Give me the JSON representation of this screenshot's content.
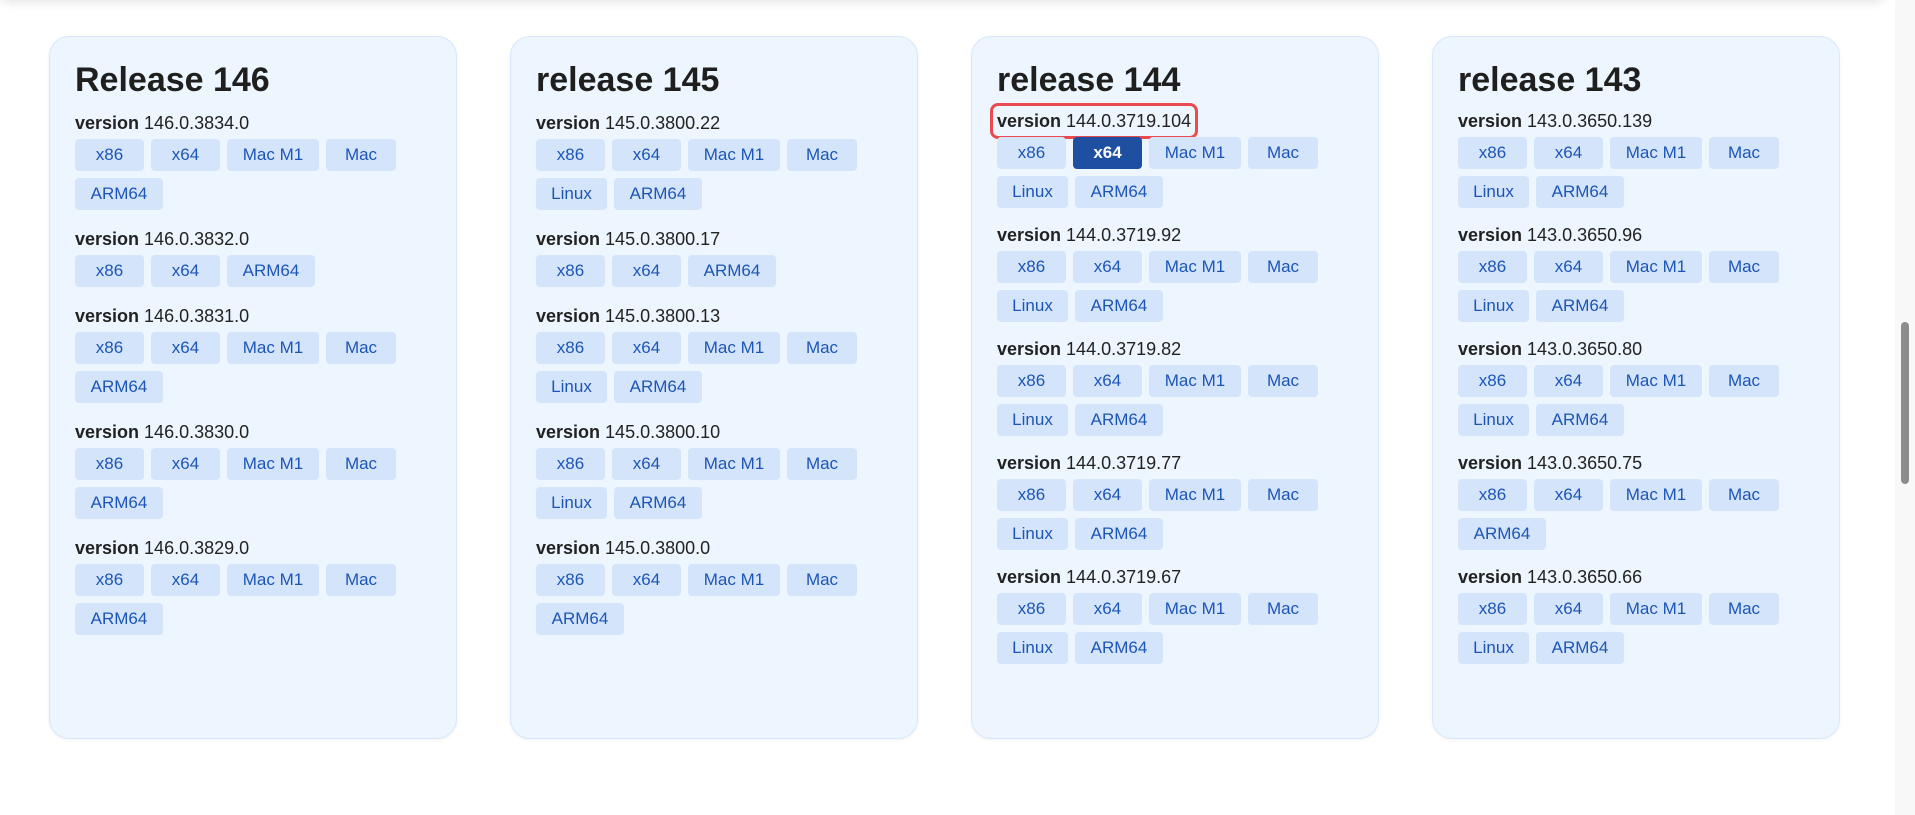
{
  "releases": [
    {
      "title": "Release 146",
      "versions": [
        {
          "label": "version",
          "value": "146.0.3834.0",
          "buttons": [
            "x86",
            "x64",
            "Mac M1",
            "Mac",
            "ARM64"
          ]
        },
        {
          "label": "version",
          "value": "146.0.3832.0",
          "buttons": [
            "x86",
            "x64",
            "ARM64"
          ]
        },
        {
          "label": "version",
          "value": "146.0.3831.0",
          "buttons": [
            "x86",
            "x64",
            "Mac M1",
            "Mac",
            "ARM64"
          ]
        },
        {
          "label": "version",
          "value": "146.0.3830.0",
          "buttons": [
            "x86",
            "x64",
            "Mac M1",
            "Mac",
            "ARM64"
          ]
        },
        {
          "label": "version",
          "value": "146.0.3829.0",
          "buttons": [
            "x86",
            "x64",
            "Mac M1",
            "Mac",
            "ARM64"
          ]
        }
      ]
    },
    {
      "title": "release 145",
      "versions": [
        {
          "label": "version",
          "value": "145.0.3800.22",
          "buttons": [
            "x86",
            "x64",
            "Mac M1",
            "Mac",
            "Linux",
            "ARM64"
          ]
        },
        {
          "label": "version",
          "value": "145.0.3800.17",
          "buttons": [
            "x86",
            "x64",
            "ARM64"
          ]
        },
        {
          "label": "version",
          "value": "145.0.3800.13",
          "buttons": [
            "x86",
            "x64",
            "Mac M1",
            "Mac",
            "Linux",
            "ARM64"
          ]
        },
        {
          "label": "version",
          "value": "145.0.3800.10",
          "buttons": [
            "x86",
            "x64",
            "Mac M1",
            "Mac",
            "Linux",
            "ARM64"
          ]
        },
        {
          "label": "version",
          "value": "145.0.3800.0",
          "buttons": [
            "x86",
            "x64",
            "Mac M1",
            "Mac",
            "ARM64"
          ]
        }
      ]
    },
    {
      "title": "release 144",
      "versions": [
        {
          "label": "version",
          "value": "144.0.3719.104",
          "highlighted": true,
          "selected_button": "x64",
          "buttons": [
            "x86",
            "x64",
            "Mac M1",
            "Mac",
            "Linux",
            "ARM64"
          ]
        },
        {
          "label": "version",
          "value": "144.0.3719.92",
          "buttons": [
            "x86",
            "x64",
            "Mac M1",
            "Mac",
            "Linux",
            "ARM64"
          ]
        },
        {
          "label": "version",
          "value": "144.0.3719.82",
          "buttons": [
            "x86",
            "x64",
            "Mac M1",
            "Mac",
            "Linux",
            "ARM64"
          ]
        },
        {
          "label": "version",
          "value": "144.0.3719.77",
          "buttons": [
            "x86",
            "x64",
            "Mac M1",
            "Mac",
            "Linux",
            "ARM64"
          ]
        },
        {
          "label": "version",
          "value": "144.0.3719.67",
          "buttons": [
            "x86",
            "x64",
            "Mac M1",
            "Mac",
            "Linux",
            "ARM64"
          ]
        }
      ]
    },
    {
      "title": "release 143",
      "versions": [
        {
          "label": "version",
          "value": "143.0.3650.139",
          "buttons": [
            "x86",
            "x64",
            "Mac M1",
            "Mac",
            "Linux",
            "ARM64"
          ]
        },
        {
          "label": "version",
          "value": "143.0.3650.96",
          "buttons": [
            "x86",
            "x64",
            "Mac M1",
            "Mac",
            "Linux",
            "ARM64"
          ]
        },
        {
          "label": "version",
          "value": "143.0.3650.80",
          "buttons": [
            "x86",
            "x64",
            "Mac M1",
            "Mac",
            "Linux",
            "ARM64"
          ]
        },
        {
          "label": "version",
          "value": "143.0.3650.75",
          "buttons": [
            "x86",
            "x64",
            "Mac M1",
            "Mac",
            "ARM64"
          ]
        },
        {
          "label": "version",
          "value": "143.0.3650.66",
          "buttons": [
            "x86",
            "x64",
            "Mac M1",
            "Mac",
            "Linux",
            "ARM64"
          ]
        }
      ]
    }
  ],
  "colors": {
    "card_background": "#edf5fe",
    "chip_background": "#d4e5fb",
    "chip_text": "#1d55b6",
    "selected_chip_background": "#1f4fa1",
    "highlight_border": "#ea4b51"
  }
}
